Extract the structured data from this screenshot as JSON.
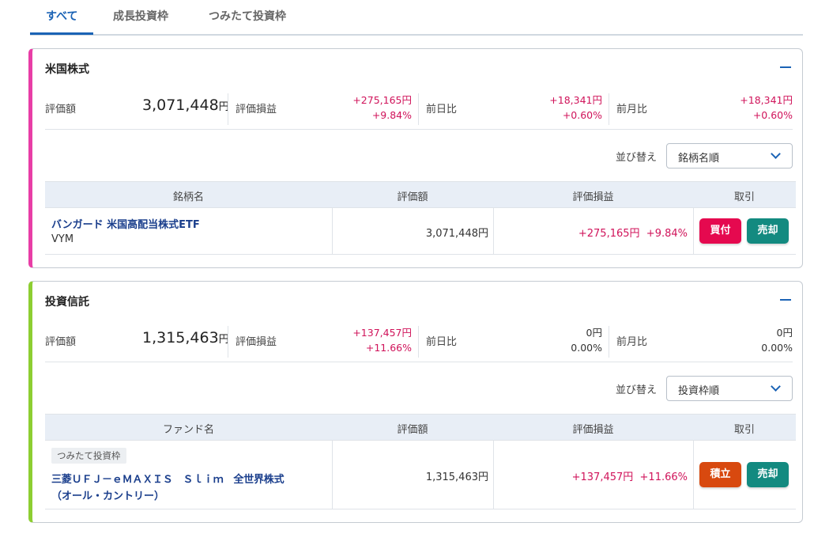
{
  "tabs": [
    {
      "label": "すべて",
      "active": true
    },
    {
      "label": "成長投資枠",
      "active": false
    },
    {
      "label": "つみたて投資枠",
      "active": false
    }
  ],
  "colors": {
    "accent": "#1b63b5",
    "stock_bar": "#e83ea6",
    "fund_bar": "#8dce32",
    "gain": "#d0135a",
    "buy": "#e5094f",
    "sell": "#138a80",
    "accum": "#d8490f"
  },
  "us_stock": {
    "title": "米国株式",
    "collapse_icon": "minus-icon",
    "summary": {
      "eval_label": "評価額",
      "eval_value": "3,071,448",
      "yen": "円",
      "pl_label": "評価損益",
      "pl_amount": "+275,165円",
      "pl_pct": "+9.84%",
      "day_label": "前日比",
      "day_amount": "+18,341円",
      "day_pct": "+0.60%",
      "month_label": "前月比",
      "month_amount": "+18,341円",
      "month_pct": "+0.60%"
    },
    "sort": {
      "label": "並び替え",
      "value": "銘柄名順"
    },
    "table": {
      "headers": [
        "銘柄名",
        "評価額",
        "評価損益",
        "取引"
      ],
      "rows": [
        {
          "name": "バンガード 米国高配当株式ETF",
          "ticker": "VYM",
          "value": "3,071,448円",
          "pl_amount": "+275,165円",
          "pl_pct": "+9.84%",
          "buy_label": "買付",
          "sell_label": "売却"
        }
      ]
    }
  },
  "fund": {
    "title": "投資信託",
    "collapse_icon": "minus-icon",
    "summary": {
      "eval_label": "評価額",
      "eval_value": "1,315,463",
      "yen": "円",
      "pl_label": "評価損益",
      "pl_amount": "+137,457円",
      "pl_pct": "+11.66%",
      "day_label": "前日比",
      "day_amount": "0円",
      "day_pct": "0.00%",
      "month_label": "前月比",
      "month_amount": "0円",
      "month_pct": "0.00%"
    },
    "sort": {
      "label": "並び替え",
      "value": "投資枠順"
    },
    "table": {
      "headers": [
        "ファンド名",
        "評価額",
        "評価損益",
        "取引"
      ],
      "rows": [
        {
          "badge": "つみたて投資枠",
          "name_line1": "三菱ＵＦＪ－ｅＭＡＸＩＳ　Ｓｌｉｍ　全世界株式",
          "name_line2": "（オール・カントリー）",
          "value": "1,315,463円",
          "pl_amount": "+137,457円",
          "pl_pct": "+11.66%",
          "accum_label": "積立",
          "sell_label": "売却"
        }
      ]
    }
  }
}
